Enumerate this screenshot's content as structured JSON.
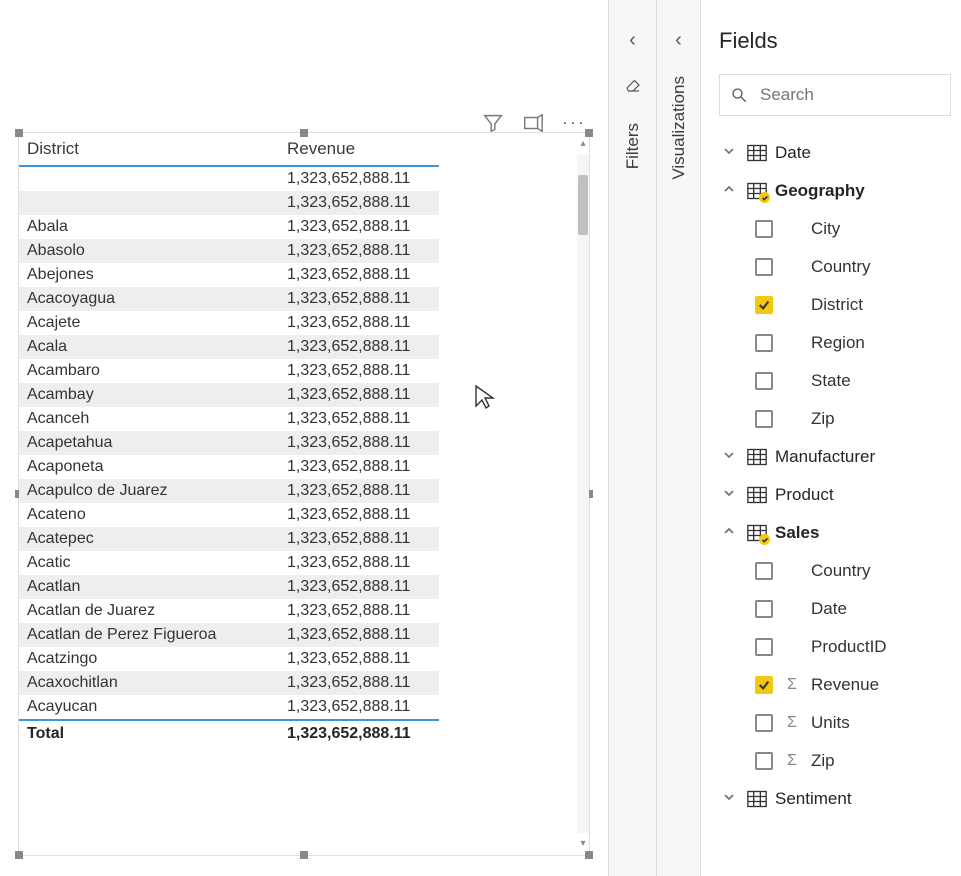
{
  "table": {
    "columns": [
      "District",
      "Revenue"
    ],
    "rows": [
      {
        "district": "",
        "revenue": "1,323,652,888.11"
      },
      {
        "district": "",
        "revenue": "1,323,652,888.11"
      },
      {
        "district": "Abala",
        "revenue": "1,323,652,888.11"
      },
      {
        "district": "Abasolo",
        "revenue": "1,323,652,888.11"
      },
      {
        "district": "Abejones",
        "revenue": "1,323,652,888.11"
      },
      {
        "district": "Acacoyagua",
        "revenue": "1,323,652,888.11"
      },
      {
        "district": "Acajete",
        "revenue": "1,323,652,888.11"
      },
      {
        "district": "Acala",
        "revenue": "1,323,652,888.11"
      },
      {
        "district": "Acambaro",
        "revenue": "1,323,652,888.11"
      },
      {
        "district": "Acambay",
        "revenue": "1,323,652,888.11"
      },
      {
        "district": "Acanceh",
        "revenue": "1,323,652,888.11"
      },
      {
        "district": "Acapetahua",
        "revenue": "1,323,652,888.11"
      },
      {
        "district": "Acaponeta",
        "revenue": "1,323,652,888.11"
      },
      {
        "district": "Acapulco de Juarez",
        "revenue": "1,323,652,888.11"
      },
      {
        "district": "Acateno",
        "revenue": "1,323,652,888.11"
      },
      {
        "district": "Acatepec",
        "revenue": "1,323,652,888.11"
      },
      {
        "district": "Acatic",
        "revenue": "1,323,652,888.11"
      },
      {
        "district": "Acatlan",
        "revenue": "1,323,652,888.11"
      },
      {
        "district": "Acatlan de Juarez",
        "revenue": "1,323,652,888.11"
      },
      {
        "district": "Acatlan de Perez Figueroa",
        "revenue": "1,323,652,888.11"
      },
      {
        "district": "Acatzingo",
        "revenue": "1,323,652,888.11"
      },
      {
        "district": "Acaxochitlan",
        "revenue": "1,323,652,888.11"
      },
      {
        "district": "Acayucan",
        "revenue": "1,323,652,888.11"
      }
    ],
    "total_label": "Total",
    "total_value": "1,323,652,888.11"
  },
  "panes": {
    "filters_label": "Filters",
    "visualizations_label": "Visualizations",
    "fields_label": "Fields"
  },
  "search": {
    "placeholder": "Search",
    "value": ""
  },
  "tables": [
    {
      "name": "Date",
      "expanded": false,
      "in_use": false,
      "fields": []
    },
    {
      "name": "Geography",
      "expanded": true,
      "in_use": true,
      "fields": [
        {
          "name": "City",
          "checked": false,
          "sigma": false
        },
        {
          "name": "Country",
          "checked": false,
          "sigma": false
        },
        {
          "name": "District",
          "checked": true,
          "sigma": false
        },
        {
          "name": "Region",
          "checked": false,
          "sigma": false
        },
        {
          "name": "State",
          "checked": false,
          "sigma": false
        },
        {
          "name": "Zip",
          "checked": false,
          "sigma": false
        }
      ]
    },
    {
      "name": "Manufacturer",
      "expanded": false,
      "in_use": false,
      "fields": []
    },
    {
      "name": "Product",
      "expanded": false,
      "in_use": false,
      "fields": []
    },
    {
      "name": "Sales",
      "expanded": true,
      "in_use": true,
      "fields": [
        {
          "name": "Country",
          "checked": false,
          "sigma": false
        },
        {
          "name": "Date",
          "checked": false,
          "sigma": false
        },
        {
          "name": "ProductID",
          "checked": false,
          "sigma": false
        },
        {
          "name": "Revenue",
          "checked": true,
          "sigma": true
        },
        {
          "name": "Units",
          "checked": false,
          "sigma": true
        },
        {
          "name": "Zip",
          "checked": false,
          "sigma": true
        }
      ]
    },
    {
      "name": "Sentiment",
      "expanded": false,
      "in_use": false,
      "fields": []
    }
  ]
}
